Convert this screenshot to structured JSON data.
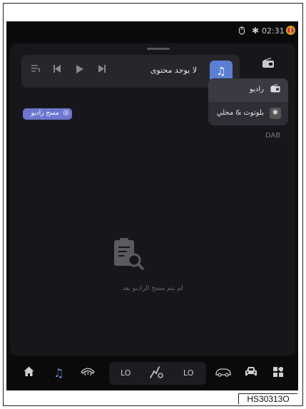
{
  "status_bar": {
    "time": "02:31",
    "icons": [
      "touch-icon",
      "bluetooth-icon",
      "logo-icon"
    ]
  },
  "player": {
    "no_content_label": "لا يوجد محتوى",
    "controls": [
      "queue-icon",
      "previous-icon",
      "play-icon",
      "next-icon"
    ]
  },
  "source_dropdown": {
    "items": [
      {
        "label": "راديو",
        "icon": "radio-icon",
        "selected": true
      },
      {
        "label": "بلوتوث & محلي",
        "icon": "bluetooth-icon",
        "selected": false
      }
    ]
  },
  "band_label": "DAB",
  "scan_button": {
    "label": "مسح راديو"
  },
  "empty_state": {
    "message": "لم يتم مسح الراديو بعد"
  },
  "nav_bar": {
    "items": [
      "home-icon",
      "music-icon",
      "rear-defrost-icon",
      "car-outline-icon",
      "car-front-icon",
      "apps-icon"
    ],
    "climate": {
      "left_temp": "LO",
      "right_temp": "LO"
    }
  },
  "figure_code": "HS30313O",
  "colors": {
    "accent": "#5b7fd3",
    "scan_button": "#6d76cf",
    "background": "#0c0c0e"
  }
}
